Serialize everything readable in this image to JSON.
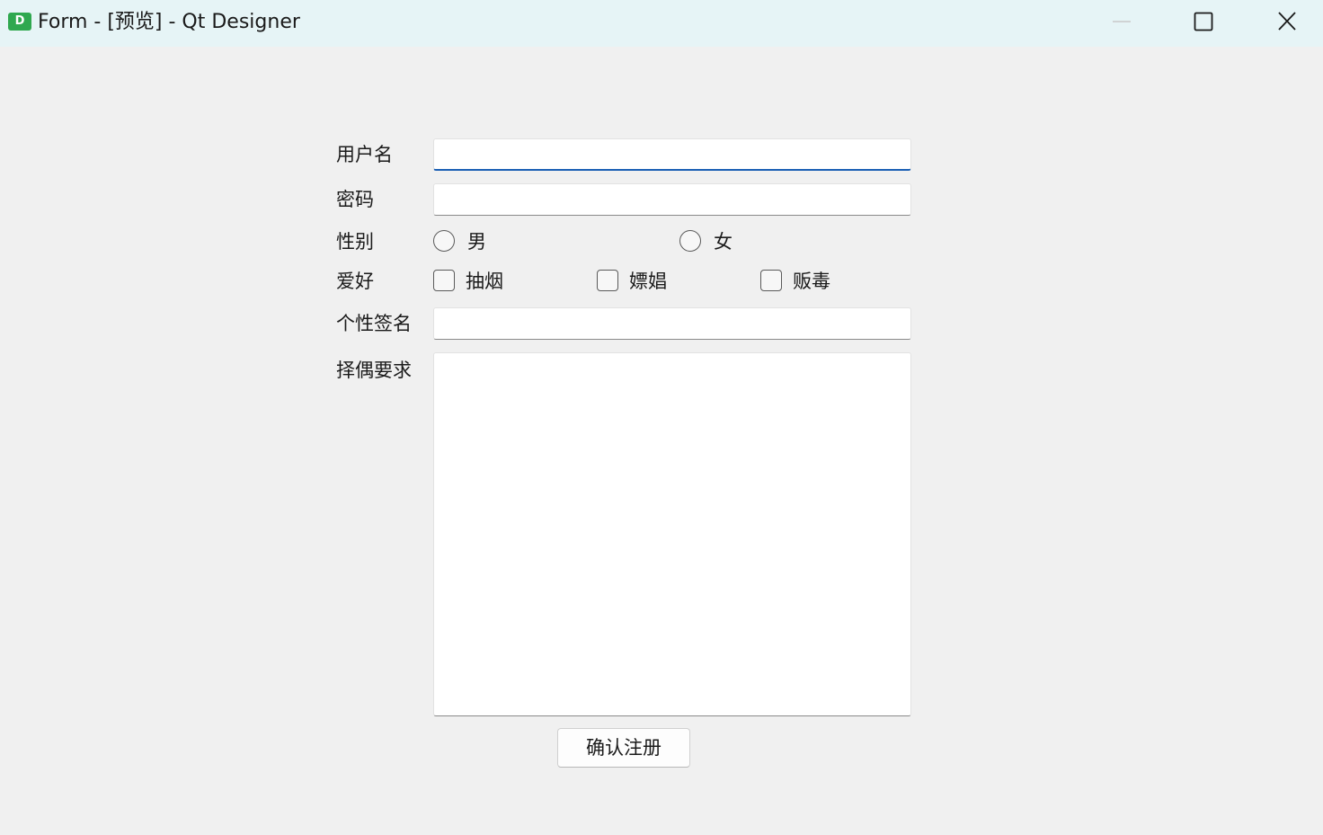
{
  "window": {
    "title": "Form - [预览] - Qt Designer",
    "app_icon_letter": "D"
  },
  "form": {
    "username_label": "用户名",
    "password_label": "密码",
    "gender_label": "性别",
    "gender_options": [
      "男",
      "女"
    ],
    "hobby_label": "爱好",
    "hobby_options": [
      "抽烟",
      "嫖娼",
      "贩毒"
    ],
    "signature_label": "个性签名",
    "requirements_label": "择偶要求",
    "submit_label": "确认注册",
    "username_value": "",
    "password_value": "",
    "signature_value": "",
    "requirements_value": ""
  }
}
